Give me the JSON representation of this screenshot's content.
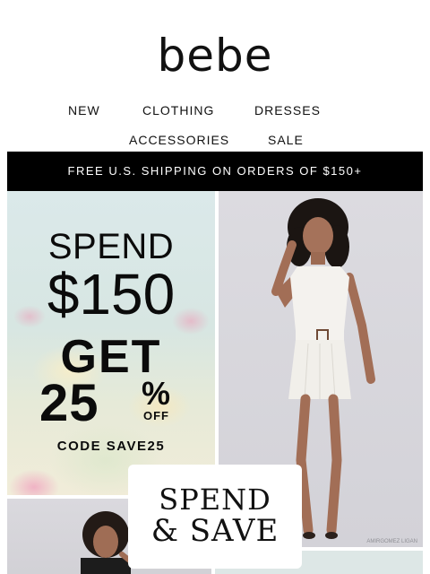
{
  "brand": {
    "logo_text": "bebe"
  },
  "nav": {
    "items": [
      {
        "label": "NEW"
      },
      {
        "label": "CLOTHING"
      },
      {
        "label": "DRESSES"
      },
      {
        "label": "ACCESSORIES"
      },
      {
        "label": "SALE"
      }
    ]
  },
  "banner": {
    "text": "FREE U.S. SHIPPING ON ORDERS OF $150+"
  },
  "promo": {
    "line1": "SPEND",
    "amount": "$150",
    "get": "GET",
    "discount_number": "25",
    "discount_percent": "%",
    "discount_off": "OFF",
    "code": "CODE SAVE25"
  },
  "hero": {
    "credit": "AMIRGOMEZ LIGAN"
  },
  "spend_save": {
    "line1": "SPEND",
    "line2": "& SAVE"
  },
  "colors": {
    "banner_bg": "#000000",
    "banner_text": "#ffffff",
    "text": "#111111"
  }
}
